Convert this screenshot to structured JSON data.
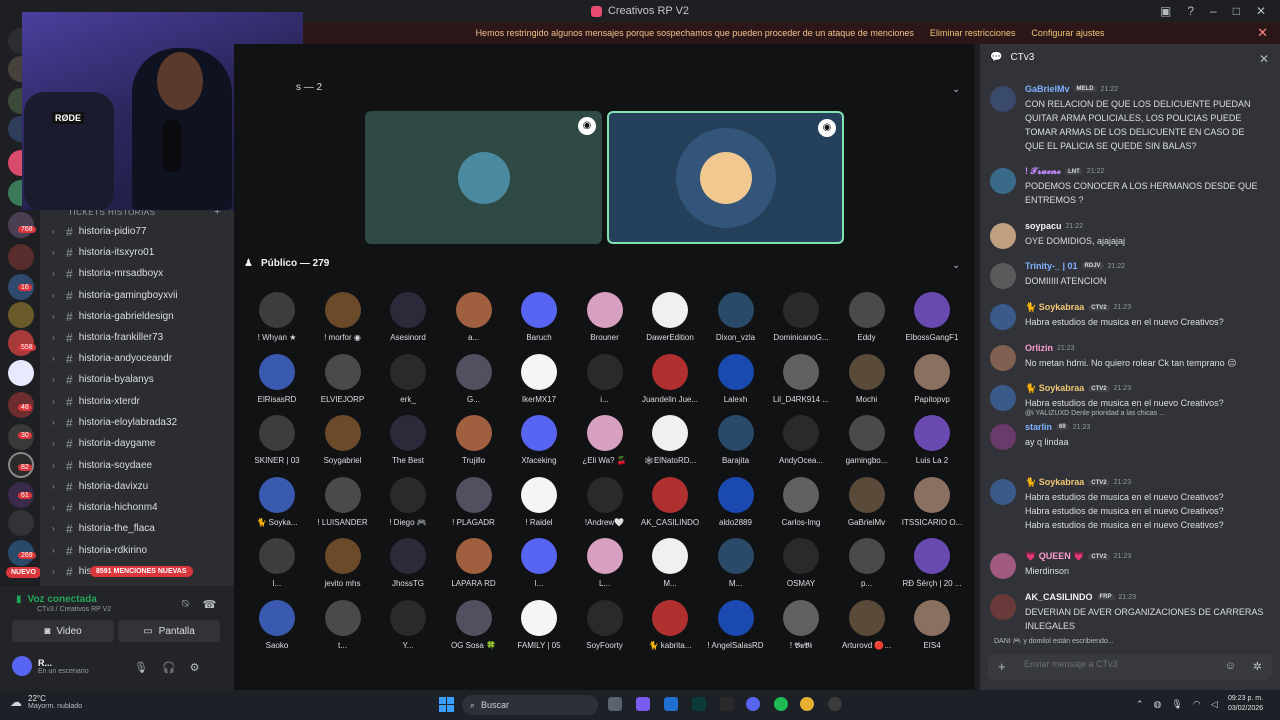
{
  "window": {
    "title": "Creativos RP V2"
  },
  "notice": {
    "text": "Hemos restringido algunos mensajes porque sospechamos que pueden proceder de un ataque de menciones",
    "action1": "Eliminar restricciones",
    "action2": "Configurar ajustes"
  },
  "servers": {
    "badges": [
      "768",
      "16",
      "558",
      "48",
      "30",
      "82",
      "61",
      "269"
    ],
    "nuevo": "NUEVO"
  },
  "sidebar": {
    "category": "TICKETS HISTORIAS",
    "channels": [
      "historia-pidio77",
      "historia-itsxyro01",
      "historia-mrsadboyx",
      "historia-gamingboyxvii",
      "historia-gabrieldesign",
      "historia-frankiller73",
      "historia-andyoceandr",
      "historia-byalanys",
      "historia-xterdr",
      "historia-eloylabrada32",
      "historia-daygame",
      "historia-soydaee",
      "historia-davixzu",
      "historia-hichonm4",
      "historia-the_flaca",
      "historia-rdkirino",
      "hist"
    ],
    "mentions": "8591 MENCIONES NUEVAS"
  },
  "voice": {
    "status": "Voz conectada",
    "location": "CTv3 / Creativos RP V2",
    "video": "Video",
    "screen": "Pantalla"
  },
  "user": {
    "name": "R...",
    "status": "En un escenario"
  },
  "stage": {
    "speakers_header": "s — 2",
    "audience_header": "Público — 279"
  },
  "audience": [
    "! Whyan ★",
    "! morfor ◉",
    "Asesinord",
    "a...",
    "Baruch",
    "Brouner",
    "DawerEdition",
    "Dixon_vzla",
    "DominicanoG...",
    "Eddy",
    "ElbossGangF1",
    "ElRisasRD",
    "ELVIEJORP",
    "erk_",
    "G...",
    "IkerMX17",
    "i...",
    "Juandelin Jue...",
    "Lalexh",
    "Lil_D4RK914 ...",
    "Mochi",
    "Papitopvp",
    "SKINER | 03",
    "Soygabriel",
    "The Best",
    "Trujillo",
    "Xfaceking",
    "¿Eli Wa? 🍒",
    "🕸ElNatoRD...",
    "Barajita",
    "AndyOcea...",
    "gamingbo...",
    "Luis La 2",
    "🐈 Soyka...",
    "! LUISANDER",
    "! Diego 🎮",
    "! PLAGADR",
    "! Raidel",
    "!Andrew🤍",
    "AK_CASILINDO",
    "aldo2889",
    "Carlos-lmg",
    "GaBrielMv",
    "ITSSICARIO O...",
    "l...",
    "jevito mhs",
    "JhossTG",
    "LAPARA RD",
    "l...",
    "L...",
    "M...",
    "M...",
    "OSMAY",
    "p...",
    "RĐ Śērçh | 20 ...",
    "Saoko",
    "t...",
    "Y...",
    "OG Sosa 🍀",
    "FAMILY | 05",
    "SoyFoorty",
    "🐈 kabrita...",
    "! AngelSalasRD",
    "! 𝕭𝖚𝕭𝖎",
    "Arturovd 🔴...",
    "EIS4"
  ],
  "chat": {
    "channel": "CTv3",
    "messages": [
      {
        "author": "GaBrielMv",
        "tag": "MELD",
        "time": "21:22",
        "text": "CON RELACION DE QUE LOS DELICUENTE PUEDAN QUITAR ARMA POLICIALES,  LOS POLICIAS PUEDE TOMAR ARMAS DE LOS DELICUENTE EN CASO DE QUE EL PALICIA SE QUEDE SIN BALAS?",
        "color": "#7fb0ff"
      },
      {
        "author": "! 𝓣𝓻𝓾𝓮𝓷𝓸",
        "tag": "LNT",
        "time": "21:22",
        "text": "PODEMOS CONOCER A LOS HERMANOS DESDE QUE ENTREMOS ?",
        "color": "#c58aff"
      },
      {
        "author": "soypacu",
        "tag": "",
        "time": "21:22",
        "text": "OYE DOMIDIOS, ajajajaj",
        "color": "#f2f3f5"
      },
      {
        "author": "Trinity-_ | 01",
        "tag": "RDJV",
        "time": "21:22",
        "text": "DOMIIIII ATENCION",
        "color": "#7fb0ff"
      },
      {
        "author": "🐈 Soykabraa",
        "tag": "CTV2",
        "time": "21:23",
        "text": "Habra estudios de musica en el nuevo Creativos?",
        "color": "#f0c674"
      },
      {
        "author": "Orlizin",
        "tag": "",
        "time": "21:23",
        "text": "No metan hdmi. No quiero rolear Ck tan temprano 😔",
        "color": "#ff9ecf"
      },
      {
        "author": "🐈 Soykabraa",
        "tag": "CTV2",
        "time": "21:23",
        "text": "Habra estudios de musica en el nuevo Creativos?",
        "color": "#f0c674"
      },
      {
        "author": "starlin",
        "tag": "69",
        "time": "21:23",
        "text": "ay q lindaa",
        "color": "#7fb0ff",
        "reply": "@i  YALIZUXD  Denle prioridad a las chicas ..."
      },
      {
        "author": "🐈 Soykabraa",
        "tag": "CTV2",
        "time": "21:23",
        "text": "Habra estudios de musica en el nuevo Creativos?\nHabra estudios de musica en el nuevo Creativos?\nHabra estudios de musica en el nuevo Creativos?",
        "color": "#f0c674"
      },
      {
        "author": "💗 QUEEN 💗",
        "tag": "CTV2",
        "time": "21:23",
        "text": "Mierdinson",
        "color": "#ff9ecf"
      },
      {
        "author": "AK_CASILINDO",
        "tag": "FRP",
        "time": "21:23",
        "text": "DEVERIAN DE AVER  ORGANIZACIONES  DE CARRERAS INLEGALES",
        "color": "#f2f3f5"
      }
    ],
    "typing": "DANI 🎮 y domilol están escribiendo...",
    "placeholder": "Enviar mensaje a CTv3"
  },
  "taskbar": {
    "temp": "22°C",
    "weather": "Mayorm. nublado",
    "search": "Buscar",
    "time": "09:23 p. m.",
    "date": "03/02/2026"
  }
}
